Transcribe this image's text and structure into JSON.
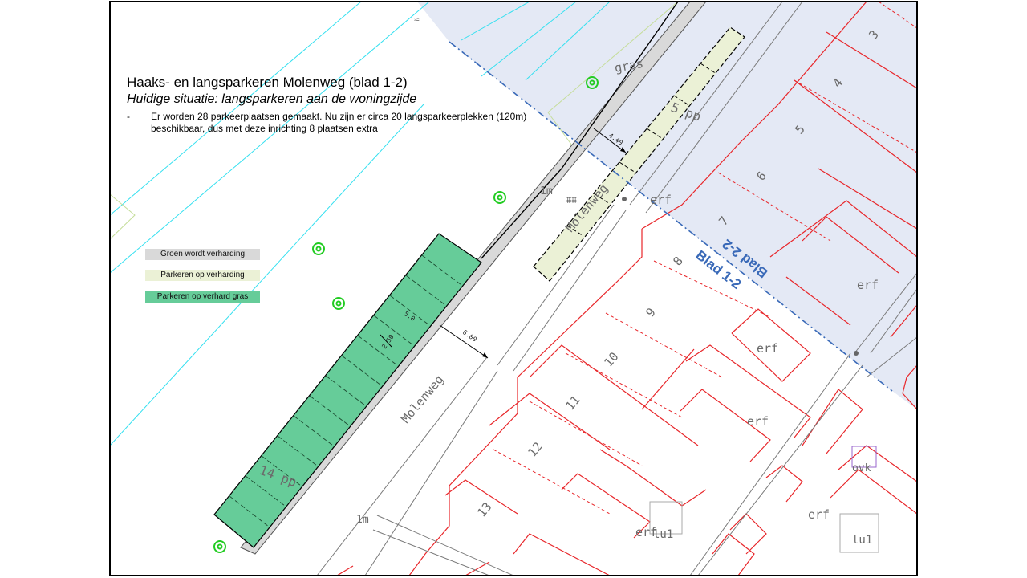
{
  "title": "Haaks- en langsparkeren Molenweg (blad 1-2)",
  "subtitle": "Huidige situatie: langsparkeren aan de woningzijde",
  "bullet": {
    "marker": "-",
    "text": "Er worden 28 parkeerplaatsen gemaakt. Nu zijn er circa 20 langsparkeerplekken (120m) beschikbaar, dus met deze inrichting 8 plaatsen extra"
  },
  "legend": [
    {
      "label": "Groen wordt verharding",
      "color": "#d9d9d9"
    },
    {
      "label": "Parkeren op verharding",
      "color": "#ebf1d6"
    },
    {
      "label": "Parkeren op verhard gras",
      "color": "#66cc99"
    }
  ],
  "map_labels": {
    "street_name_top": "Molenweg",
    "street_name_bottom": "Molenweg",
    "parking_count_green": "14 pp",
    "parking_count_yellow": "5 pp",
    "sheet_current": "Blad 1-2",
    "sheet_adjacent": "Blad 2-2",
    "grass": "gras",
    "width_1m_top": "1m",
    "width_1m_bottom": "1m",
    "dim_4_40": "4.40",
    "dim_6_00": "6.00",
    "dim_5_0": "5.0",
    "dim_2_50": "2.50",
    "erf_1": "erf",
    "erf_2": "erf",
    "erf_3": "erf",
    "erf_4": "erf",
    "erf_5": "erf",
    "erf_6": "erf",
    "ovk": "ovk",
    "lu_1": "lu1",
    "lu_2": "lu1",
    "house_3": "3",
    "house_4": "4",
    "house_5": "5",
    "house_6": "6",
    "house_7": "7",
    "house_8": "8",
    "house_9": "9",
    "house_10": "10",
    "house_11": "11",
    "house_12": "12",
    "house_13": "13"
  },
  "colors": {
    "adjacent_sheet_fill": "#e4e9f5",
    "grey_strip": "#d9d9d9",
    "yellow_parking": "#ebf1d6",
    "green_parking": "#66cc99",
    "parcel_lines": "#e8262a",
    "water_lines": "#33e0f0",
    "tree_symbol": "#22cc22",
    "sheet_boundary": "#3a6ab8"
  }
}
